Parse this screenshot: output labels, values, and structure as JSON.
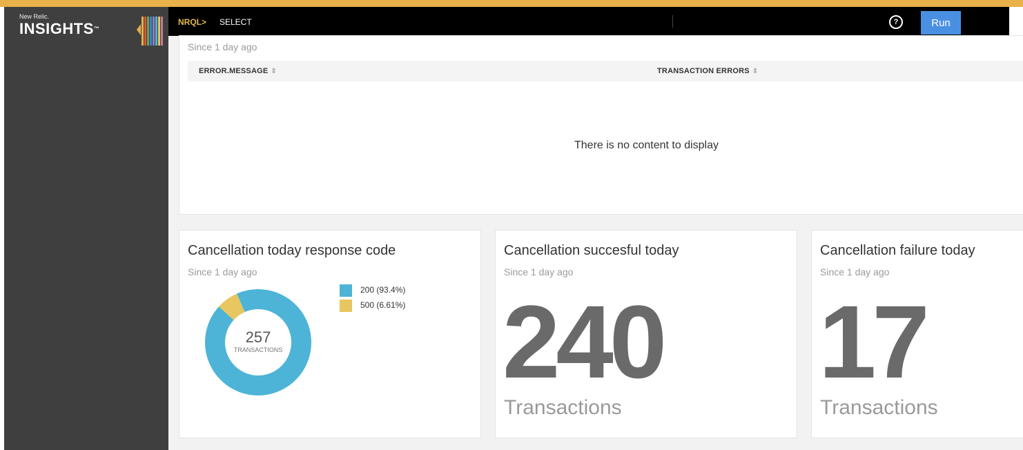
{
  "app": {
    "logo_small": "New Relic.",
    "logo_big": "INSIGHTS",
    "trademark": "™"
  },
  "query_bar": {
    "prompt": "NRQL>",
    "value": "SELECT",
    "help_icon": "help-circle-icon",
    "run_label": "Run"
  },
  "colors": {
    "accent": "#e9b14a",
    "run_button": "#4a90e2",
    "series_200": "#4db4d7",
    "series_500": "#e8c660"
  },
  "errors_widget": {
    "subtitle": "Since 1 day ago",
    "columns": [
      "ERROR.MESSAGE",
      "TRANSACTION ERRORS"
    ],
    "sort_icon": "sort-icon",
    "empty_message": "There is no content to display"
  },
  "response_code_widget": {
    "title": "Cancellation today response code",
    "subtitle": "Since 1 day ago",
    "total": "257",
    "total_label": "TRANSACTIONS",
    "legend": [
      {
        "label": "200 (93.4%)",
        "color": "#4db4d7"
      },
      {
        "label": "500 (6.61%)",
        "color": "#e8c660"
      }
    ]
  },
  "success_widget": {
    "title": "Cancellation succesful today",
    "subtitle": "Since 1 day ago",
    "value": "240",
    "unit": "Transactions"
  },
  "failure_widget": {
    "title": "Cancellation failure today",
    "subtitle": "Since 1 day ago",
    "value": "17",
    "unit": "Transactions"
  },
  "chart_data": {
    "type": "pie",
    "categories": [
      "200",
      "500"
    ],
    "values": [
      93.4,
      6.61
    ]
  }
}
